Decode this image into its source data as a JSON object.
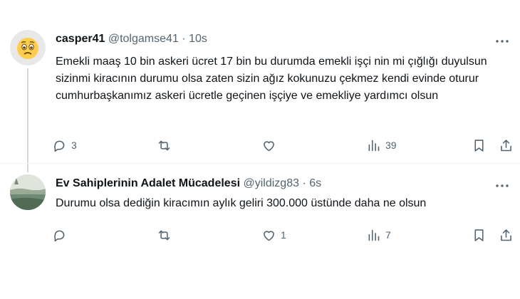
{
  "tweets": [
    {
      "name": "casper41",
      "handle": "@tolgamse41",
      "dot": "·",
      "time": "10s",
      "text": "Emekli maaş 10 bin askeri ücret 17 bin bu durumda emekli işçi nin mi çığlığı duyulsun sizinmi kiracının durumu olsa zaten sizin ağız kokunuzu çekmez kendi evinde oturur cumhurbaşkanımız askeri ücretle geçinen işçiye ve emekliye yardımcı olsun",
      "reply_count": "3",
      "retweet_count": "",
      "like_count": "",
      "view_count": "39",
      "avatar": "worried-face-emoji-avatar"
    },
    {
      "name": "Ev Sahiplerinin Adalet Mücadelesi",
      "handle": "@yildizg83",
      "dot": "·",
      "time": "6s",
      "text": "Durumu olsa dediğin kiracımın aylık geliri 300.000 üstünde daha ne olsun",
      "reply_count": "",
      "retweet_count": "",
      "like_count": "1",
      "view_count": "7",
      "avatar": "sea-landscape-photo-avatar"
    }
  ],
  "icons": [
    "more-icon",
    "reply-icon",
    "retweet-icon",
    "like-icon",
    "views-icon",
    "bookmark-icon",
    "share-icon"
  ],
  "colors": {
    "text": "#0f1419",
    "secondary": "#536471",
    "divider": "#eff3f4",
    "thread_line": "#cfd9de"
  }
}
